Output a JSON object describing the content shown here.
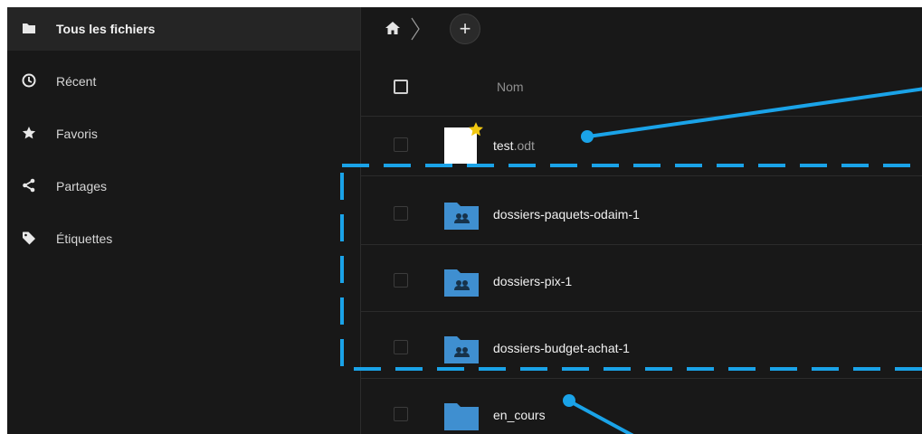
{
  "sidebar": {
    "items": [
      {
        "label": "Tous les fichiers",
        "icon": "folder-icon"
      },
      {
        "label": "Récent",
        "icon": "clock-icon"
      },
      {
        "label": "Favoris",
        "icon": "star-icon"
      },
      {
        "label": "Partages",
        "icon": "share-icon"
      },
      {
        "label": "Étiquettes",
        "icon": "tag-icon"
      }
    ]
  },
  "breadcrumb": {
    "home_icon": "home-icon",
    "add_label": "+"
  },
  "table": {
    "header_name": "Nom",
    "rows": [
      {
        "name": "test",
        "ext": ".odt",
        "type": "document",
        "favorite": true
      },
      {
        "name": "dossiers-paquets-odaim-1",
        "ext": "",
        "type": "shared-folder"
      },
      {
        "name": "dossiers-pix-1",
        "ext": "",
        "type": "shared-folder"
      },
      {
        "name": "dossiers-budget-achat-1",
        "ext": "",
        "type": "shared-folder"
      },
      {
        "name": "en_cours",
        "ext": "",
        "type": "folder"
      }
    ]
  },
  "colors": {
    "background": "#181818",
    "sidebar_active": "#252525",
    "folder_blue": "#3f8fd0",
    "annotation": "#1aa3e8",
    "favorite_star": "#f2c811"
  }
}
